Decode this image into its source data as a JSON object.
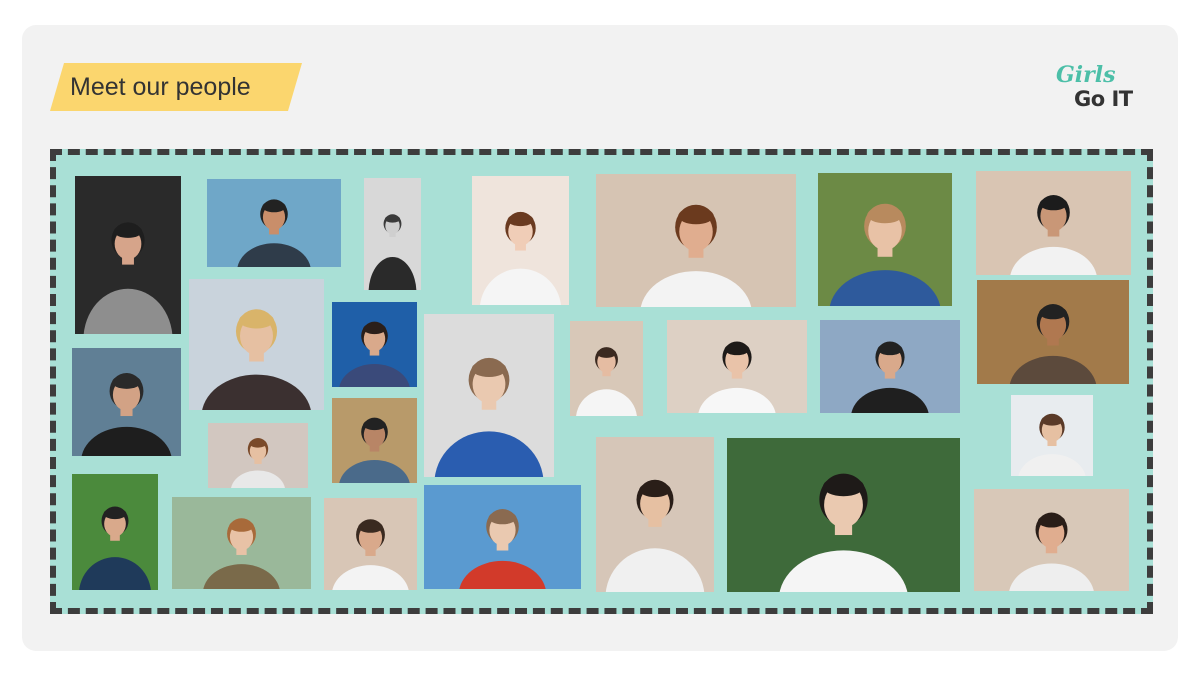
{
  "header": {
    "title": "Meet our people"
  },
  "logo": {
    "line1": "Girls",
    "line2": "Go IT"
  },
  "colors": {
    "card": "#f2f2f2",
    "tag": "#fbd66e",
    "board": "#a9e0d6",
    "border": "#3d3d3d",
    "logo_accent": "#4cbfa8"
  },
  "people": [
    {
      "bg": "#2a2a2a",
      "skin": "#d6a48a",
      "hair": "#1e1e1e",
      "shirt": "#8e8e8e"
    },
    {
      "bg": "#6fa7c8",
      "skin": "#c98e6a",
      "hair": "#222222",
      "shirt": "#2f3c4a"
    },
    {
      "bg": "#d8d8d8",
      "skin": "#cfcfcf",
      "hair": "#3a3a3a",
      "shirt": "#2a2a2a"
    },
    {
      "bg": "#efe4dc",
      "skin": "#f0cdb7",
      "hair": "#6a3a20",
      "shirt": "#f5f5f5"
    },
    {
      "bg": "#d6c4b3",
      "skin": "#e0ad8f",
      "hair": "#6b3a1e",
      "shirt": "#f3f3f3"
    },
    {
      "bg": "#6c8a45",
      "skin": "#e8c2a6",
      "hair": "#b88a5e",
      "shirt": "#2e5a9c"
    },
    {
      "bg": "#d9c5b3",
      "skin": "#c99777",
      "hair": "#1c1c1c",
      "shirt": "#f2f2f2"
    },
    {
      "bg": "#c9d3dc",
      "skin": "#e6c0a2",
      "hair": "#d9b46a",
      "shirt": "#3b3030"
    },
    {
      "bg": "#1f5fa8",
      "skin": "#d9a98b",
      "hair": "#2b1f1a",
      "shirt": "#3a4a7a"
    },
    {
      "bg": "#607f95",
      "skin": "#d2a285",
      "hair": "#2a2a2a",
      "shirt": "#1e1e1e"
    },
    {
      "bg": "#dcdcdc",
      "skin": "#eac9b0",
      "hair": "#8a6a50",
      "shirt": "#2a5db0"
    },
    {
      "bg": "#d8c8b8",
      "skin": "#e5bca2",
      "hair": "#3b2a20",
      "shirt": "#f5f5f5"
    },
    {
      "bg": "#ddd0c4",
      "skin": "#e9c3a9",
      "hair": "#1e1a18",
      "shirt": "#f7f7f7"
    },
    {
      "bg": "#8ea8c4",
      "skin": "#d9a98b",
      "hair": "#222222",
      "shirt": "#1f1f1f"
    },
    {
      "bg": "#a27a4a",
      "skin": "#b07850",
      "hair": "#222222",
      "shirt": "#5c4a3c"
    },
    {
      "bg": "#d2c7c0",
      "skin": "#e6c0a2",
      "hair": "#7a4a2a",
      "shirt": "#e8e8e8"
    },
    {
      "bg": "#b89a6a",
      "skin": "#b88566",
      "hair": "#222222",
      "shirt": "#4a6a8a"
    },
    {
      "bg": "#e8ecef",
      "skin": "#e6c0a2",
      "hair": "#5a3a28",
      "shirt": "#f0f0f0"
    },
    {
      "bg": "#4b8a3c",
      "skin": "#d9a98b",
      "hair": "#222222",
      "shirt": "#1f3a5a"
    },
    {
      "bg": "#9ab89a",
      "skin": "#e8c2a6",
      "hair": "#a86a3a",
      "shirt": "#7a6a4a"
    },
    {
      "bg": "#d8c6b6",
      "skin": "#d9a98b",
      "hair": "#3a2a20",
      "shirt": "#f3f3f3"
    },
    {
      "bg": "#5a9ad0",
      "skin": "#eac9b0",
      "hair": "#8a6a50",
      "shirt": "#d23a2a"
    },
    {
      "bg": "#d6c6b8",
      "skin": "#e6c0a2",
      "hair": "#2a1e18",
      "shirt": "#f0f0f0"
    },
    {
      "bg": "#3e6a3a",
      "skin": "#eac9b0",
      "hair": "#1e1a18",
      "shirt": "#f5f5f5"
    },
    {
      "bg": "#d8c8b8",
      "skin": "#e0ad8f",
      "hair": "#2a1e18",
      "shirt": "#eeeeee"
    },
    {
      "bg": "#d8c8b8",
      "skin": "#eac9b0",
      "hair": "#3a2a20",
      "shirt": "#f5f5f5"
    }
  ]
}
